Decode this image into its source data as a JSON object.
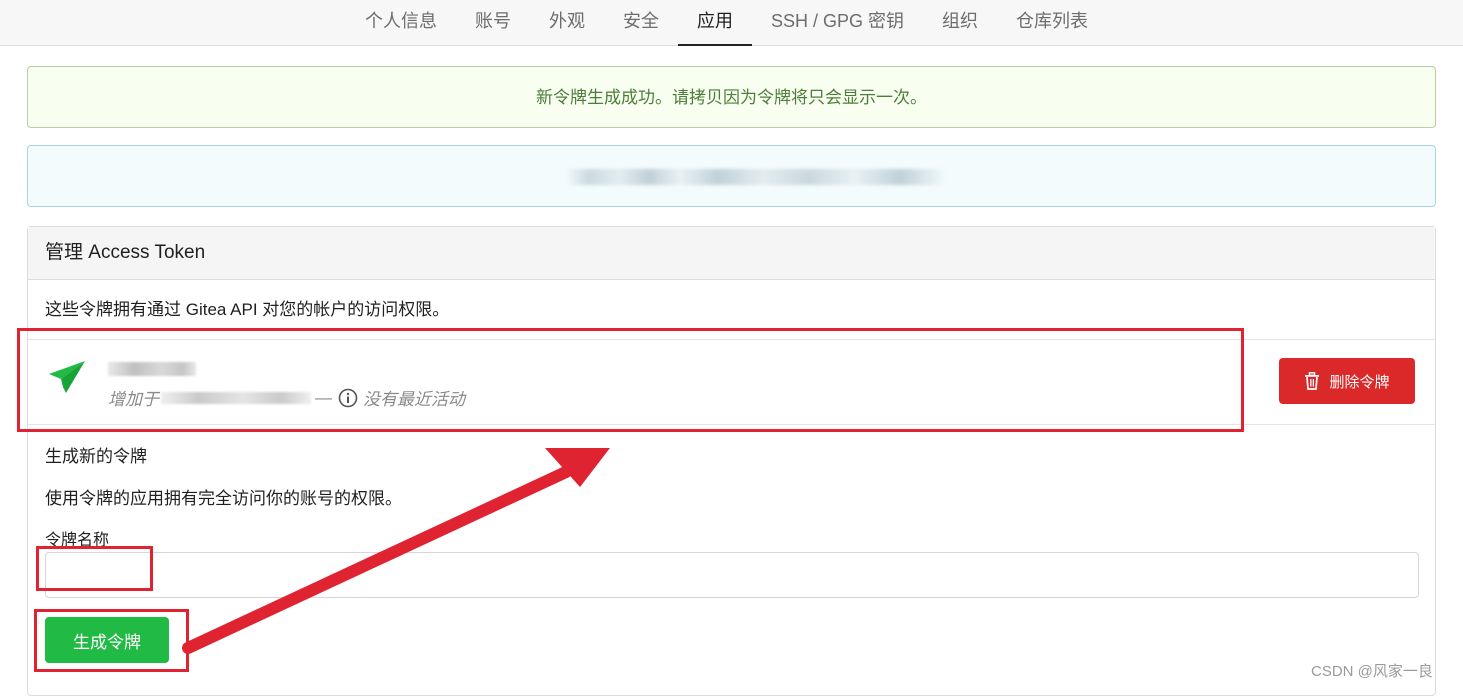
{
  "nav": {
    "tabs": [
      {
        "label": "个人信息",
        "active": false
      },
      {
        "label": "账号",
        "active": false
      },
      {
        "label": "外观",
        "active": false
      },
      {
        "label": "安全",
        "active": false
      },
      {
        "label": "应用",
        "active": true
      },
      {
        "label": "SSH / GPG 密钥",
        "active": false
      },
      {
        "label": "组织",
        "active": false
      },
      {
        "label": "仓库列表",
        "active": false
      }
    ]
  },
  "messages": {
    "success": "新令牌生成成功。请拷贝因为令牌将只会显示一次。"
  },
  "access_token": {
    "header": "管理 Access Token",
    "description": "这些令牌拥有通过 Gitea API 对您的帐户的访问权限。",
    "token": {
      "added_prefix": "增加于",
      "separator": "—",
      "activity": "没有最近活动",
      "delete_label": "删除令牌"
    }
  },
  "generate": {
    "title": "生成新的令牌",
    "description": "使用令牌的应用拥有完全访问你的账号的权限。",
    "name_label": "令牌名称",
    "name_value": "",
    "button_label": "生成令牌"
  },
  "watermark": "CSDN @风家一良",
  "colors": {
    "success_text": "#4d7d38",
    "delete": "#db2828",
    "primary": "#21ba45",
    "annotation": "#e02330"
  }
}
